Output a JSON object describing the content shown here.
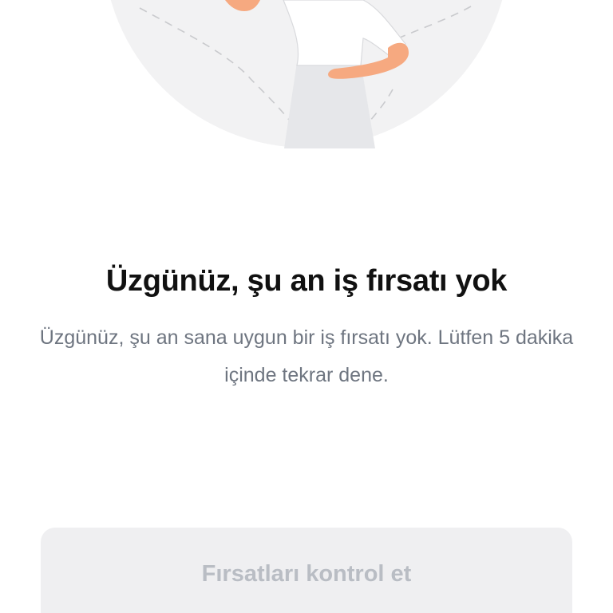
{
  "empty_state": {
    "title": "Üzgünüz, şu an iş fırsatı yok",
    "message": "Üzgünüz, şu an sana uygun bir iş fırsatı yok. Lütfen 5 dakika içinde tekrar dene.",
    "illustration_icon": "woman-waiting-illustration"
  },
  "actions": {
    "check_opportunities_label": "Fırsatları kontrol et",
    "check_opportunities_enabled": false
  },
  "colors": {
    "background": "#ffffff",
    "title_text": "#111111",
    "body_text": "#6e7580",
    "button_bg_disabled": "#efeff1",
    "button_text_disabled": "#b9bdc4",
    "illustration_circle": "#f2f2f3",
    "skin_tone": "#f6a980"
  }
}
